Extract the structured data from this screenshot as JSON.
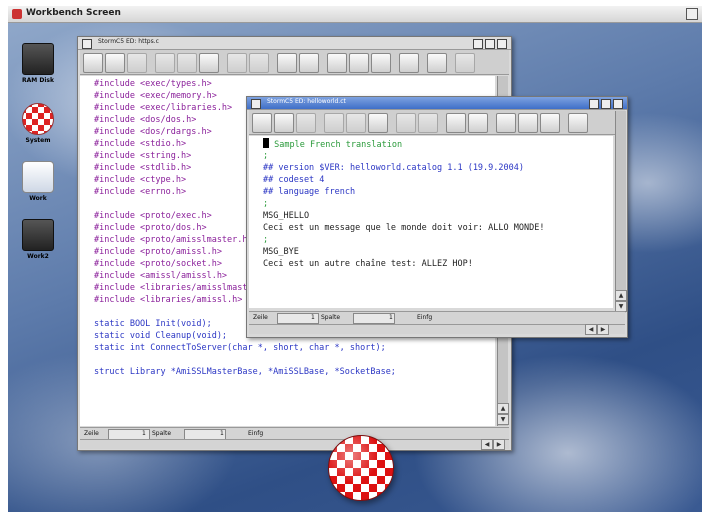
{
  "screen": {
    "title": "Workbench Screen"
  },
  "desktop_icons": [
    {
      "label": "RAM Disk",
      "icon": "drive-icon"
    },
    {
      "label": "System",
      "icon": "boing-ball-icon"
    },
    {
      "label": "Work",
      "icon": "disk-icon"
    },
    {
      "label": "Work2",
      "icon": "drive-icon"
    }
  ],
  "back_window": {
    "title": "StormC5 ED: https.c",
    "lines": [
      "#include <exec/types.h>",
      "#include <exec/memory.h>",
      "#include <exec/libraries.h>",
      "#include <dos/dos.h>",
      "#include <dos/rdargs.h>",
      "#include <stdio.h>",
      "#include <string.h>",
      "#include <stdlib.h>",
      "#include <ctype.h>",
      "#include <errno.h>",
      "",
      "#include <proto/exec.h>",
      "#include <proto/dos.h>",
      "#include <proto/amisslmaster.h>",
      "#include <proto/amissl.h>",
      "#include <proto/socket.h>",
      "#include <amissl/amissl.h>",
      "#include <libraries/amisslmaster.h>",
      "#include <libraries/amissl.h>",
      "",
      "static BOOL Init(void);",
      "static void Cleanup(void);",
      "static int ConnectToServer(char *, short, char *, short);",
      "",
      "struct Library *AmiSSLMasterBase, *AmiSSLBase, *SocketBase;"
    ],
    "status": {
      "zeile_label": "Zeile",
      "zeile_value": "1",
      "spalte_label": "Spalte",
      "spalte_value": "1",
      "mode": "Einfg"
    }
  },
  "front_window": {
    "title": "StormC5 ED: helloworld.ct",
    "lines": [
      "Sample French translation",
      ";",
      "## version $VER: helloworld.catalog 1.1 (19.9.2004)",
      "## codeset 4",
      "## language french",
      ";",
      "MSG_HELLO",
      "Ceci est un message que le monde doit voir: ALLO MONDE!",
      ";",
      "MSG_BYE",
      "Ceci est un autre chaîne test: ALLEZ HOP!"
    ],
    "status": {
      "zeile_label": "Zeile",
      "zeile_value": "1",
      "spalte_label": "Spalte",
      "spalte_value": "1",
      "mode": "Einfg"
    }
  }
}
